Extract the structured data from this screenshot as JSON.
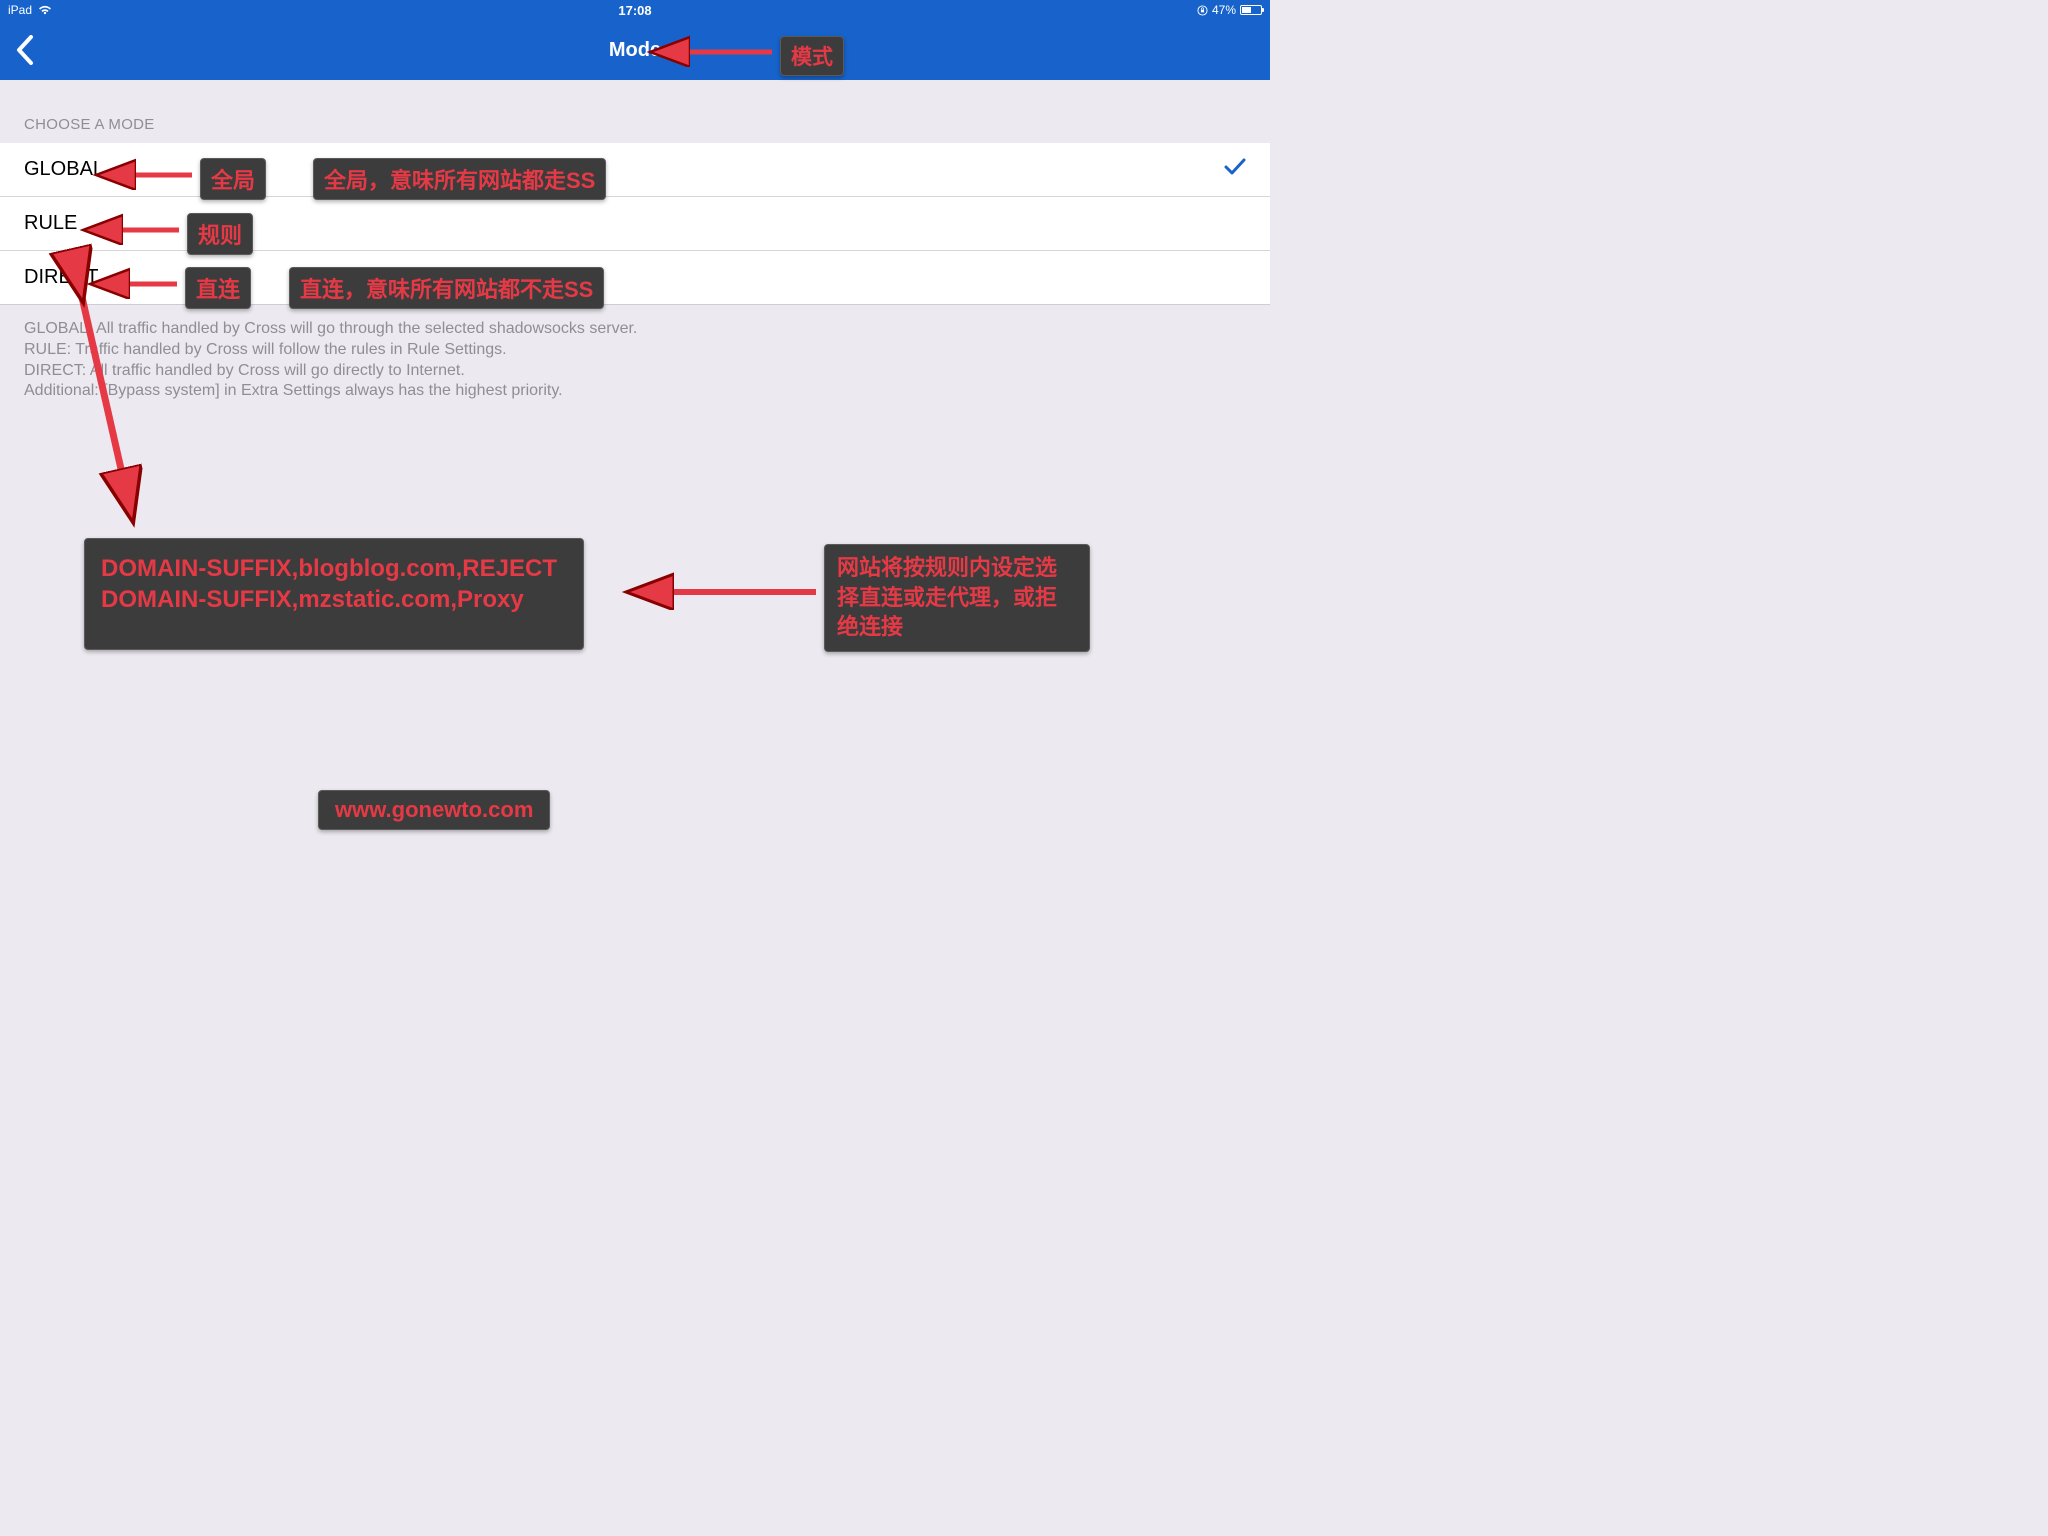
{
  "status": {
    "device": "iPad",
    "time": "17:08",
    "battery_pct": "47%"
  },
  "nav": {
    "title": "Mode"
  },
  "section": {
    "header": "CHOOSE A MODE",
    "options": {
      "global": "GLOBAL",
      "rule": "RULE",
      "direct": "DIRECT"
    },
    "selected": "GLOBAL",
    "footer": {
      "l1": "GLOBAL: All traffic handled by Cross will go through the selected shadowsocks server.",
      "l2": "RULE: Traffic handled by Cross will follow the rules in Rule Settings.",
      "l3": "DIRECT: All traffic handled by Cross will go directly to Internet.",
      "l4": "Additional: [Bypass system] in Extra Settings always has the highest priority."
    }
  },
  "annotations": {
    "mode": "模式",
    "global_label": "全局",
    "global_desc": "全局，意味所有网站都走SS",
    "rule_label": "规则",
    "direct_label": "直连",
    "direct_desc": "直连，意味所有网站都不走SS",
    "rule_example_l1": "DOMAIN-SUFFIX,blogblog.com,REJECT",
    "rule_example_l2": "DOMAIN-SUFFIX,mzstatic.com,Proxy",
    "rule_desc": "网站将按规则内设定选择直连或走代理，或拒绝连接",
    "watermark": "www.gonewto.com"
  }
}
